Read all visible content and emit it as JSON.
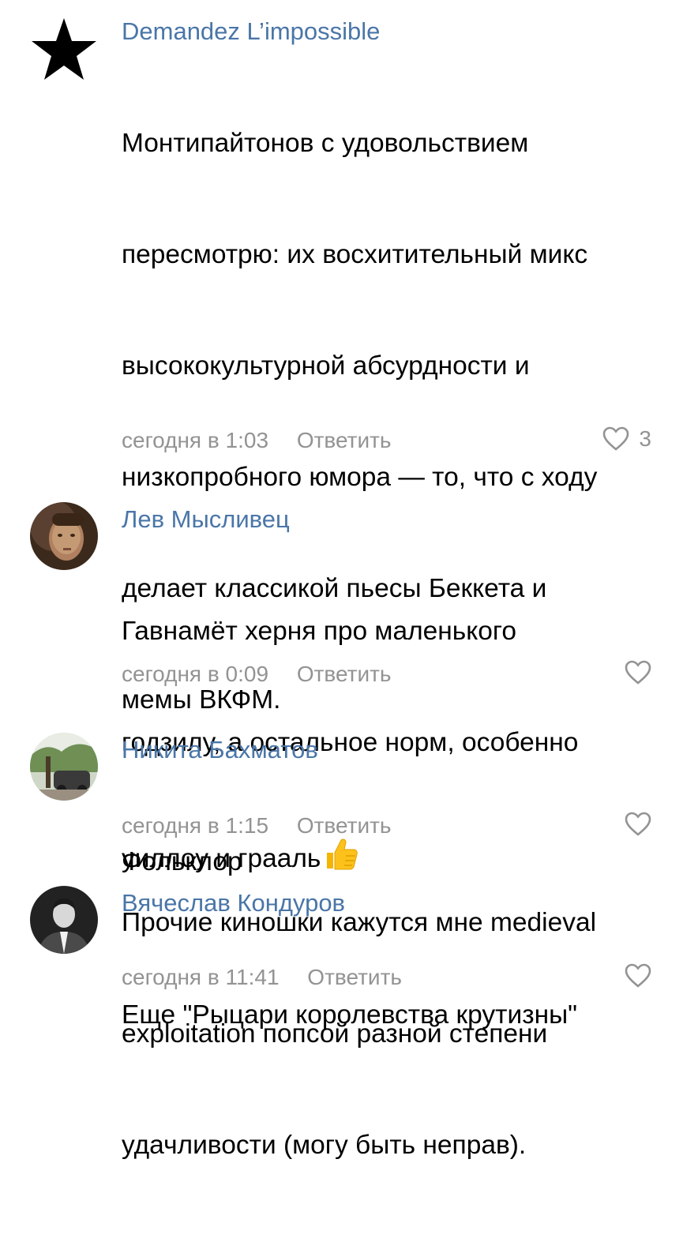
{
  "comments": [
    {
      "author": "Demandez L’impossible",
      "avatar": "star-icon",
      "text_lines": [
        "Монтипайтонов с удовольствием",
        "пересмотрю: их восхитительный микс",
        "высококультурной абсурдности и",
        "низкопробного юмора — то, что с ходу",
        "делает классикой пьесы Беккета и",
        "мемы ВКФМ.",
        "",
        "Прочие киношки кажутся мне medieval",
        "exploitation попсой разной степени",
        "удачливости (могу быть неправ)."
      ],
      "time": "сегодня в 1:03",
      "reply": "Ответить",
      "likes": "3"
    },
    {
      "author": "Лев Мысливец",
      "avatar": "portrait-photo",
      "text_lines": [
        "Гавнамёт херня про маленького",
        "годзилу, а остальное норм, особенно",
        "уиллоу и грааль"
      ],
      "emoji": "thumbs-up-icon",
      "time": "сегодня в 0:09",
      "reply": "Ответить",
      "likes": ""
    },
    {
      "author": "Никита Бахматов",
      "avatar": "street-photo",
      "text_lines": [
        "Фольклор"
      ],
      "time": "сегодня в 1:15",
      "reply": "Ответить",
      "likes": ""
    },
    {
      "author": "Вячеслав Кондуров",
      "avatar": "man-photo",
      "text_lines": [
        "Еще \"Рыцари королевства крутизны\""
      ],
      "time": "сегодня в 11:41",
      "reply": "Ответить",
      "likes": ""
    }
  ],
  "colors": {
    "author": "#4a76a8",
    "meta": "#939393",
    "text": "#000000",
    "background": "#ffffff"
  }
}
